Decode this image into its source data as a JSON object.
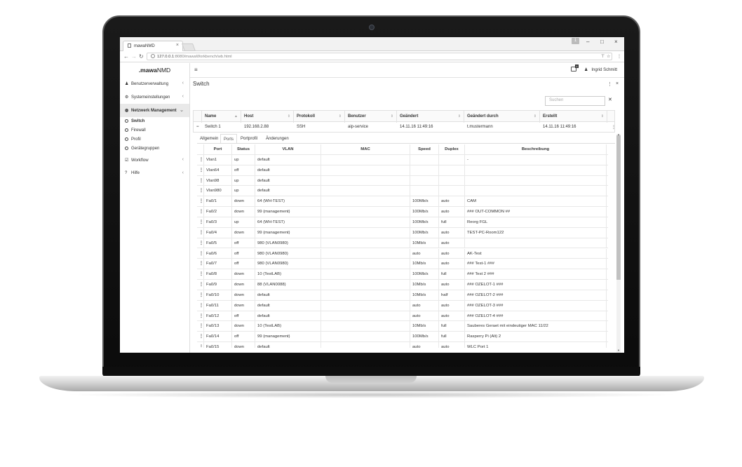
{
  "browser": {
    "tab_title": "mawaNMD",
    "url_host": "127.0.0.1",
    "url_path": ":8080/mawaWorkbench/wb.html",
    "user_badge": "1"
  },
  "app": {
    "brand_prefix": ".mawa",
    "brand_suffix": "NMD",
    "notification_count": "4",
    "user_name": "Ingrid Schmitt"
  },
  "sidebar": {
    "items": [
      {
        "label": "Benutzerverwaltung",
        "icon": "user-icon"
      },
      {
        "label": "Systemeinstellungen",
        "icon": "gear-icon"
      },
      {
        "label": "Netzwerk Management",
        "icon": "globe-icon"
      },
      {
        "label": "Workflow",
        "icon": "checkbox-icon"
      },
      {
        "label": "Hilfe",
        "icon": "help-icon"
      }
    ],
    "sub_items": [
      "Switch",
      "Firewall",
      "Profil",
      "Gerätegruppen"
    ]
  },
  "main": {
    "title": "Switch",
    "search_placeholder": "Suchen",
    "grid": {
      "headers": [
        "Name",
        "Host",
        "Protokoll",
        "Benutzer",
        "Geändert",
        "Geändert durch",
        "Erstellt"
      ],
      "row": [
        "Switch 1",
        "192.168.2.88",
        "SSH",
        "aip-service",
        "14.11.16 11:49:16",
        "t.mustermann",
        "14.11.16 11:49:16"
      ]
    },
    "tabs": [
      "Allgemein",
      "Ports",
      "Portprofil",
      "Änderungen"
    ],
    "active_tab": "Ports",
    "ports": {
      "headers": [
        "Port",
        "Status",
        "VLAN",
        "MAC",
        "Speed",
        "Duplex",
        "Beschreibung"
      ],
      "rows": [
        [
          "Vlan1",
          "up",
          "default",
          "",
          "",
          "",
          "-"
        ],
        [
          "Vlan64",
          "off",
          "default",
          "",
          "",
          "",
          ""
        ],
        [
          "Vlan98",
          "up",
          "default",
          "",
          "",
          "",
          ""
        ],
        [
          "Vlan980",
          "up",
          "default",
          "",
          "",
          "",
          ""
        ],
        [
          "Fa0/1",
          "down",
          "64 (WH-TEST)",
          "",
          "100Mb/s",
          "auto",
          "CAM"
        ],
        [
          "Fa0/2",
          "down",
          "99 (management)",
          "",
          "100Mb/s",
          "auto",
          "### OUT-COMMON ##"
        ],
        [
          "Fa0/3",
          "up",
          "64 (WH-TEST)",
          "",
          "100Mb/s",
          "full",
          "Reorg FGL"
        ],
        [
          "Fa0/4",
          "down",
          "99 (management)",
          "",
          "100Mb/s",
          "auto",
          "TEST-PC-Room122"
        ],
        [
          "Fa0/5",
          "off",
          "980 (VLAN0980)",
          "",
          "10Mb/s",
          "auto",
          ""
        ],
        [
          "Fa0/6",
          "off",
          "980 (VLAN0980)",
          "",
          "auto",
          "auto",
          "AK-Test"
        ],
        [
          "Fa0/7",
          "off",
          "980 (VLAN0980)",
          "",
          "10Mb/s",
          "auto",
          "### Test-1 ###"
        ],
        [
          "Fa0/8",
          "down",
          "10 (TestLAB)",
          "",
          "100Mb/s",
          "full",
          "### Test 2 ###"
        ],
        [
          "Fa0/9",
          "down",
          "88 (VLAN0088)",
          "",
          "10Mb/s",
          "auto",
          "### OZELOT-1 ###"
        ],
        [
          "Fa0/10",
          "down",
          "default",
          "",
          "10Mb/s",
          "half",
          "### OZELOT-2 ###"
        ],
        [
          "Fa0/11",
          "down",
          "default",
          "",
          "auto",
          "auto",
          "### OZELOT-3 ###"
        ],
        [
          "Fa0/12",
          "off",
          "default",
          "",
          "auto",
          "auto",
          "### OZELOT-4 ###"
        ],
        [
          "Fa0/13",
          "down",
          "10 (TestLAB)",
          "",
          "10Mb/s",
          "full",
          "Sauberes Geraet mit eindeutiger MAC 11/22"
        ],
        [
          "Fa0/14",
          "off",
          "99 (management)",
          "",
          "100Mb/s",
          "full",
          "Rasperry Pi (Alt) 2"
        ],
        [
          "Fa0/15",
          "down",
          "default",
          "",
          "auto",
          "auto",
          "WLC Port 1"
        ]
      ]
    }
  }
}
